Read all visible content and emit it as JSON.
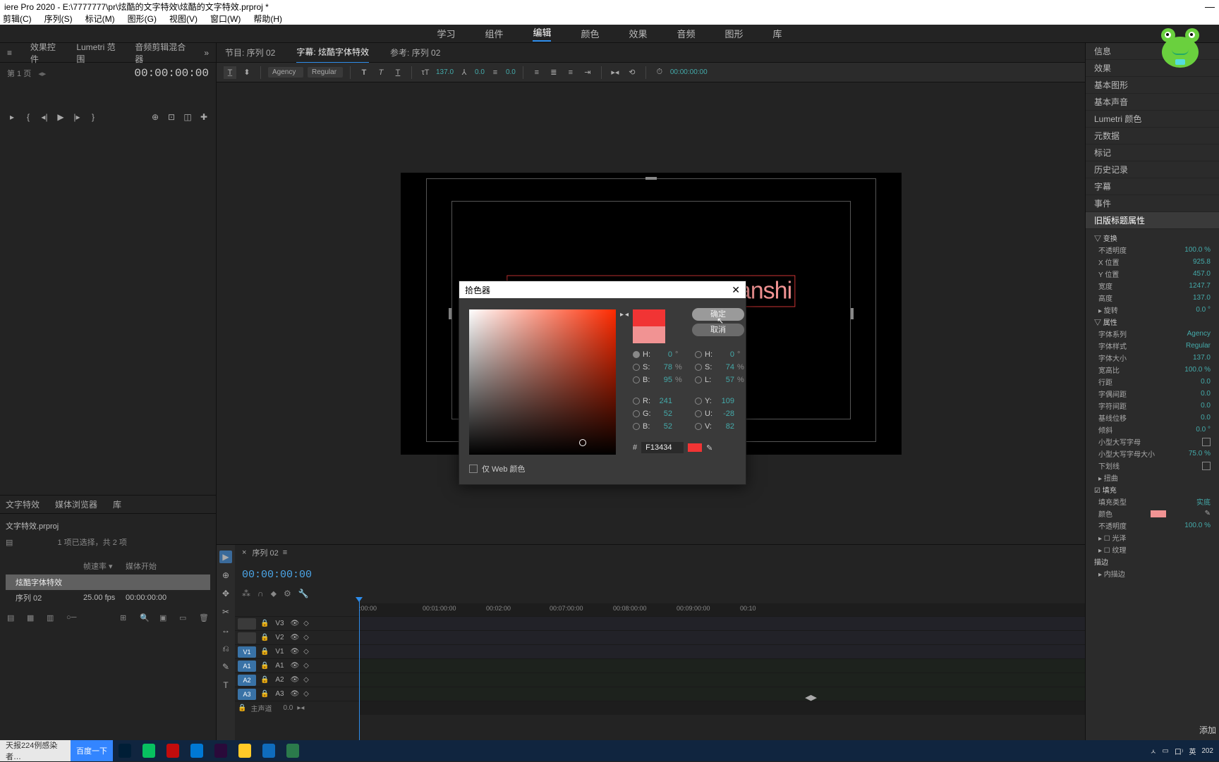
{
  "title": "iere Pro 2020 - E:\\7777777\\pr\\炫酷的文字特效\\炫酷的文字特效.prproj *",
  "menu": [
    "剪辑(C)",
    "序列(S)",
    "标记(M)",
    "图形(G)",
    "视图(V)",
    "窗口(W)",
    "帮助(H)"
  ],
  "workspaces": [
    "学习",
    "组件",
    "编辑",
    "颜色",
    "效果",
    "音频",
    "图形",
    "库"
  ],
  "ws_active_index": 2,
  "left_panel_tabs": [
    "效果控件",
    "Lumetri 范围",
    "音频剪辑混合器"
  ],
  "source_tabs": {
    "items": [
      "节目: 序列 02",
      "字幕: 炫酷字体特效",
      "参考: 序列 02"
    ],
    "active": 1
  },
  "text_toolbar": {
    "font": "Agency",
    "weight": "Regular",
    "size": "137.0",
    "tracking": "0.0",
    "leading": "0.0",
    "tc": "00:00:00:00"
  },
  "canvas_text": "xuankudezitixiaoguozhanshi",
  "transport": {
    "page": "第 1 页",
    "tc": "00:00:00:00"
  },
  "project": {
    "tabs": [
      "文字特效",
      "媒体浏览器",
      "库"
    ],
    "name": "文字特效.prproj",
    "info": "1 项已选择，共 2 项",
    "cols": [
      "帧速率 ▾",
      "媒体开始"
    ],
    "rows": [
      {
        "name": "炫酷字体特效",
        "fps": "",
        "start": ""
      },
      {
        "name": "序列 02",
        "fps": "25.00 fps",
        "start": "00:00:00:00"
      }
    ],
    "sel_row": 0
  },
  "timeline": {
    "tab": "序列 02",
    "tc": "00:00:00:00",
    "ticks": [
      ":00:00",
      "00:01:00:00",
      "00:02:00",
      "00:07:00:00",
      "00:08:00:00",
      "00:09:00:00",
      "00:10"
    ],
    "vtracks": [
      "V3",
      "V2",
      "V1"
    ],
    "atracks": [
      "A1",
      "A2",
      "A3"
    ],
    "master": "主声道",
    "master_val": "0.0"
  },
  "tools": [
    "▶",
    "⊕",
    "✥",
    "✂",
    "↔",
    "⎌",
    "✎",
    "T"
  ],
  "right_panels": [
    "信息",
    "效果",
    "基本图形",
    "基本声音",
    "Lumetri 颜色",
    "元数据",
    "标记",
    "历史记录",
    "字幕",
    "事件",
    "旧版标题属性"
  ],
  "right_sel": 10,
  "props": {
    "变换": "变换",
    "不透明度": {
      "l": "不透明度",
      "v": "100.0 %"
    },
    "X位置": {
      "l": "X 位置",
      "v": "925.8"
    },
    "Y位置": {
      "l": "Y 位置",
      "v": "457.0"
    },
    "宽度": {
      "l": "宽度",
      "v": "1247.7"
    },
    "高度": {
      "l": "高度",
      "v": "137.0"
    },
    "旋转": {
      "l": "▸ 旋转",
      "v": "0.0 °"
    },
    "属性": "属性",
    "字体系列": {
      "l": "字体系列",
      "v": "Agency"
    },
    "字体样式": {
      "l": "字体样式",
      "v": "Regular"
    },
    "字体大小": {
      "l": "字体大小",
      "v": "137.0"
    },
    "宽高比": {
      "l": "宽高比",
      "v": "100.0 %"
    },
    "行距": {
      "l": "行距",
      "v": "0.0"
    },
    "字偶间距": {
      "l": "字偶间距",
      "v": "0.0"
    },
    "字符间距": {
      "l": "字符间距",
      "v": "0.0"
    },
    "基线位移": {
      "l": "基线位移",
      "v": "0.0"
    },
    "倾斜": {
      "l": "倾斜",
      "v": "0.0 °"
    },
    "小型大写字母": {
      "l": "小型大写字母"
    },
    "小型大写字母大小": {
      "l": "小型大写字母大小",
      "v": "75.0 %"
    },
    "下划线": {
      "l": "下划线"
    },
    "扭曲": "▸ 扭曲",
    "填充": "☑ 填充",
    "填充类型": {
      "l": "填充类型",
      "v": "实底"
    },
    "颜色": {
      "l": "颜色"
    },
    "不透明度2": {
      "l": "不透明度",
      "v": "100.0 %"
    },
    "光泽": "▸ ☐ 光泽",
    "纹理": "▸ ☐ 纹理",
    "描边": "描边",
    "内描边": "▸ 内描边",
    "添加": "添加"
  },
  "picker": {
    "title": "拾色器",
    "ok": "确定",
    "cancel": "取消",
    "web": "仅 Web 颜色",
    "H": {
      "l": "H:",
      "v": "0",
      "u": "°"
    },
    "S": {
      "l": "S:",
      "v": "78",
      "u": "%"
    },
    "B": {
      "l": "B:",
      "v": "95",
      "u": "%"
    },
    "R": {
      "l": "R:",
      "v": "241"
    },
    "G": {
      "l": "G:",
      "v": "52"
    },
    "B2": {
      "l": "B:",
      "v": "52"
    },
    "H2": {
      "l": "H:",
      "v": "0",
      "u": "°"
    },
    "S2": {
      "l": "S:",
      "v": "74",
      "u": "%"
    },
    "L": {
      "l": "L:",
      "v": "57",
      "u": "%"
    },
    "Y": {
      "l": "Y:",
      "v": "109"
    },
    "U": {
      "l": "U:",
      "v": "-28"
    },
    "V": {
      "l": "V:",
      "v": "82"
    },
    "hex_pfx": "#",
    "hex": "F13434"
  },
  "taskbar": {
    "news": "天报224例感染者…",
    "baidu": "百度一下",
    "apps": [
      {
        "n": "ps",
        "c": "#001e36"
      },
      {
        "n": "wechat",
        "c": "#07c160"
      },
      {
        "n": "netease",
        "c": "#c20c0c"
      },
      {
        "n": "f",
        "c": "#0078d4"
      },
      {
        "n": "pr",
        "c": "#2a0a3a"
      },
      {
        "n": "explorer",
        "c": "#ffca28"
      },
      {
        "n": "edge",
        "c": "#0f6cbd"
      },
      {
        "n": "dl",
        "c": "#2b7a4b"
      }
    ],
    "tray": [
      "ㅅ",
      "▭",
      "口⁾",
      "英",
      "202"
    ]
  }
}
